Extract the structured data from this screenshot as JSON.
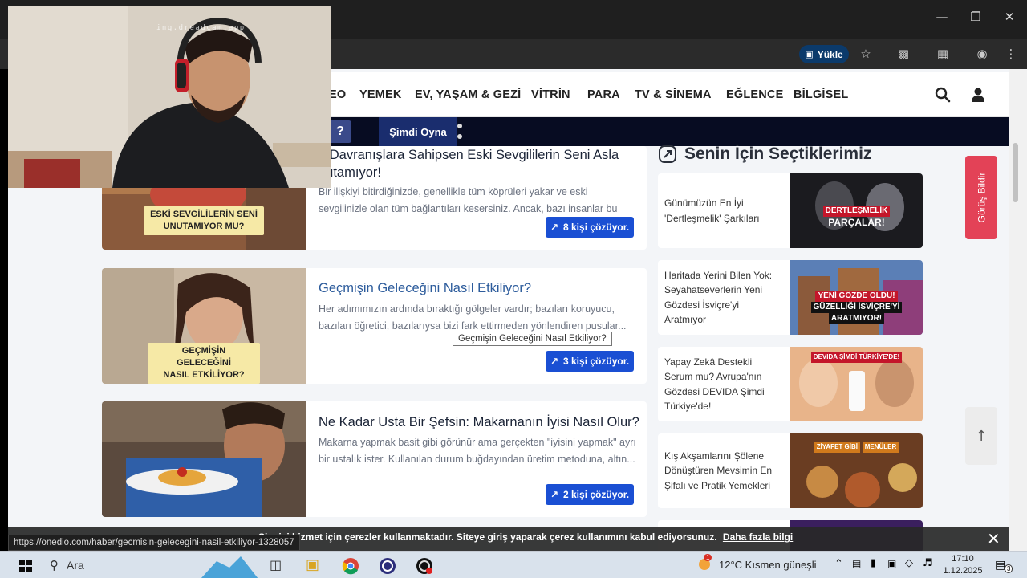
{
  "browser": {
    "install_label": "Yükle",
    "status_url": "https://onedio.com/haber/gecmisin-gelecegini-nasil-etkiliyor-1328057"
  },
  "nav": {
    "items": [
      "EO",
      "YEMEK",
      "EV, YAŞAM & GEZİ",
      "VİTRİN",
      "PARA",
      "TV & SİNEMA",
      "EĞLENCE",
      "BİLGİSEL"
    ]
  },
  "promo": {
    "help_label": "?",
    "play_label": "Şimdi Oyna"
  },
  "articles": [
    {
      "title_line1": "u Davranışlara Sahipsen Eski Sevgililerin Seni Asla",
      "title_line2": "nutamıyor!",
      "desc": "Bir ilişkiyi bitirdiğinizde, genellikle tüm köprüleri yakar ve eski sevgilinizle olan tüm bağlantıları kesersiniz. Ancak, bazı insanlar bu durumdan farkl...",
      "caption_line1": "ESKİ SEVGİLİLERİN SENİ",
      "caption_line2": "UNUTAMIYOR MU?",
      "solved": "8 kişi çözüyor."
    },
    {
      "title": "Geçmişin Geleceğini Nasıl Etkiliyor?",
      "desc": "Her adımımızın ardında bıraktığı gölgeler vardır; bazıları koruyucu, bazıları öğretici, bazılarıysa bizi fark ettirmeden yönlendiren pusular...",
      "caption_line1": "GEÇMİŞİN GELECEĞİNİ",
      "caption_line2": "NASIL ETKİLİYOR?",
      "solved": "3 kişi çözüyor.",
      "tooltip": "Geçmişin Geleceğini Nasıl Etkiliyor?"
    },
    {
      "title": "Ne Kadar Usta Bir Şefsin: Makarnanın İyisi Nasıl Olur?",
      "desc": "Makarna yapmak basit gibi görünür ama gerçekten \"iyisini yapmak\" ayrı bir ustalık ister. Kullanılan durum buğdayından üretim metoduna, altın...",
      "solved": "2 kişi çözüyor."
    }
  ],
  "sidebar": {
    "title": "Senin İçin Seçtiklerimiz",
    "items": [
      {
        "text": "Günümüzün En İyi 'Dertleşmelik' Şarkıları",
        "tag_line1": "DERTLEŞMELİK",
        "tag_line2": "PARÇALAR!"
      },
      {
        "text": "Haritada Yerini Bilen Yok: Seyahatseverlerin Yeni Gözdesi İsviçre'yi Aratmıyor",
        "tag_line1": "YENİ GÖZDE OLDU!",
        "tag_line2": "GÜZELLİĞİ İSVİÇRE'Yİ",
        "tag_line3": "ARATMIYOR!"
      },
      {
        "text": "Yapay Zekâ Destekli Serum mu? Avrupa'nın Gözdesi DEVIDA Şimdi Türkiye'de!",
        "tag_line1": "DEVIDA ŞİMDİ TÜRKİYE'DE!"
      },
      {
        "text": "Kış Akşamlarını Şölene Dönüştüren Mevsimin En Şifalı ve Pratik Yemekleri",
        "tag_line1": "ZİYAFET GİBİ",
        "tag_line2": "MENÜLER"
      }
    ]
  },
  "feedback_label": "Görüş Bildir",
  "cookie": {
    "message": "Si      n iyi hizmet için çerezler kullanmaktadır. Siteye giriş yaparak çerez kullanımını kabul ediyorsunuz.",
    "link": "Daha fazla bilgi"
  },
  "taskbar": {
    "search_label": "Ara",
    "weather": "12°C  Kısmen güneşli",
    "weather_badge": "1",
    "time": "17:10",
    "date": "1.12.2025",
    "notif_count": "3"
  },
  "webcam": {
    "watermark": "ing.dreadcam.app"
  },
  "colors": {
    "accent": "#1a4fd3",
    "link": "#2d5c9c",
    "feedback": "#e34257",
    "promo": "#070c22"
  }
}
